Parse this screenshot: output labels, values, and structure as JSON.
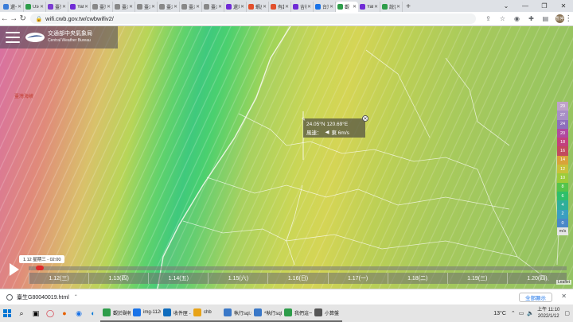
{
  "browser": {
    "tabs": [
      {
        "label": "還七日",
        "color": "#3b7dd8"
      },
      {
        "label": "User",
        "color": "#2e9d4a"
      },
      {
        "label": "臺灣",
        "color": "#7a3bd1"
      },
      {
        "label": "Yahoo",
        "color": "#6f2bd6"
      },
      {
        "label": "臺灣",
        "color": "#888888"
      },
      {
        "label": "臺北",
        "color": "#888888"
      },
      {
        "label": "臺北",
        "color": "#888888"
      },
      {
        "label": "臺北",
        "color": "#888888"
      },
      {
        "label": "臺北",
        "color": "#888888"
      },
      {
        "label": "臺北",
        "color": "#888888"
      },
      {
        "label": "還境",
        "color": "#6f2bd6"
      },
      {
        "label": "蝦皮",
        "color": "#e2502c"
      },
      {
        "label": "有趣",
        "color": "#e2502c"
      },
      {
        "label": "吉祥",
        "color": "#6f2bd6"
      },
      {
        "label": "台灣",
        "color": "#1a73e8"
      },
      {
        "label": "觀",
        "color": "#2e9d4a",
        "active": true
      },
      {
        "label": "Yahoo",
        "color": "#6f2bd6"
      },
      {
        "label": "說書",
        "color": "#2e9d4a"
      }
    ],
    "new_tab_symbol": "+",
    "url": "wifi.cwb.gov.tw/cwbwifiv2/",
    "profile_label": "暫停"
  },
  "site": {
    "name_zh": "交通部中央氣象局",
    "name_en": "Central Weather Bureau"
  },
  "map": {
    "sea_label": "臺灣海峽",
    "popup": {
      "coords": "24.05°N  120.69°E",
      "wind_label": "風速：",
      "wind_arrow": "◀",
      "wind_value": "東 6m/s"
    },
    "legend": {
      "unit": "m/s",
      "entries": [
        {
          "value": "29",
          "color": "#bfa3c9"
        },
        {
          "value": "27",
          "color": "#a88fc6"
        },
        {
          "value": "24",
          "color": "#8e6fbc"
        },
        {
          "value": "20",
          "color": "#b04aa0"
        },
        {
          "value": "18",
          "color": "#c2407e"
        },
        {
          "value": "16",
          "color": "#c24a5e"
        },
        {
          "value": "14",
          "color": "#d9a33a"
        },
        {
          "value": "12",
          "color": "#c8c23a"
        },
        {
          "value": "10",
          "color": "#9ccc3a"
        },
        {
          "value": "8",
          "color": "#55c44a"
        },
        {
          "value": "6",
          "color": "#2fbf6a"
        },
        {
          "value": "4",
          "color": "#2fae9a"
        },
        {
          "value": "2",
          "color": "#3a9fc0"
        },
        {
          "value": "0",
          "color": "#4a88c8"
        }
      ]
    },
    "attribution": "Leaflet"
  },
  "timeline": {
    "current": "1.12 星期三 - 02:00",
    "days": [
      "1.12(三)",
      "1.13(四)",
      "1.14(五)",
      "1.15(六)",
      "1.16(日)",
      "1.17(一)",
      "1.18(二)",
      "1.19(三)",
      "1.20(四)"
    ]
  },
  "download": {
    "filename": "臺生G80040019.html",
    "show_all": "全部顯示"
  },
  "taskbar": {
    "apps": [
      {
        "label": "觀於颱報",
        "color": "#2e9d4a"
      },
      {
        "label": "img-11208",
        "color": "#1a73e8"
      },
      {
        "label": "收件匣 - Mic",
        "color": "#0f6cbd"
      },
      {
        "label": "chb",
        "color": "#e8a317"
      },
      {
        "label": "執行sql.txt",
        "color": "#3a78c8"
      },
      {
        "label": "*執行sql.txt",
        "color": "#3a78c8"
      },
      {
        "label": "我們這一家",
        "color": "#2e9d4a"
      },
      {
        "label": "小算盤",
        "color": "#555555"
      }
    ],
    "weather": "13°C",
    "clock_time": "上午 11:10",
    "clock_date": "2022/1/12"
  }
}
